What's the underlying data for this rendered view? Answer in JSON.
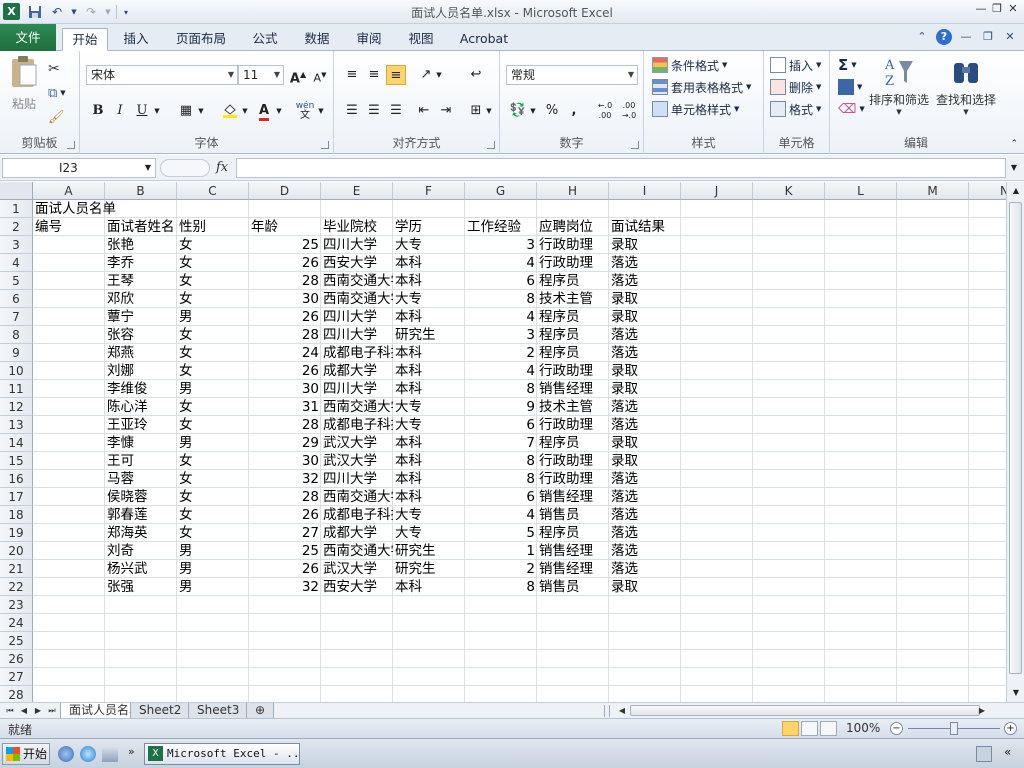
{
  "window": {
    "title": "面试人员名单.xlsx - Microsoft Excel",
    "app_icon": "X"
  },
  "ribbon_tabs": [
    "文件",
    "开始",
    "插入",
    "页面布局",
    "公式",
    "数据",
    "审阅",
    "视图",
    "Acrobat"
  ],
  "ribbon": {
    "clipboard": {
      "label": "剪贴板",
      "paste": "粘贴"
    },
    "font": {
      "label": "字体",
      "font_name": "宋体",
      "font_size": "11",
      "bold": "B",
      "italic": "I",
      "underline": "U",
      "grow": "A",
      "shrink": "A",
      "color_a": "A",
      "phonetic": "wén"
    },
    "alignment": {
      "label": "对齐方式"
    },
    "number": {
      "label": "数字",
      "format": "常规",
      "percent": "%",
      "comma": ",",
      "inc": "←.0 .00",
      "dec": ".00 →.0"
    },
    "styles": {
      "label": "样式",
      "conditional": "条件格式",
      "table": "套用表格格式",
      "cell_styles": "单元格样式"
    },
    "cells": {
      "label": "单元格",
      "insert": "插入",
      "delete": "删除",
      "format": "格式"
    },
    "editing": {
      "label": "编辑",
      "sum": "Σ",
      "sort": "排序和筛选",
      "find": "查找和选择"
    }
  },
  "formula_bar": {
    "name_box": "I23",
    "fx": "fx",
    "formula": ""
  },
  "columns": [
    "A",
    "B",
    "C",
    "D",
    "E",
    "F",
    "G",
    "H",
    "I",
    "J",
    "K",
    "L",
    "M",
    "N"
  ],
  "row_numbers": [
    "1",
    "2",
    "3",
    "4",
    "5",
    "6",
    "7",
    "8",
    "9",
    "10",
    "11",
    "12",
    "13",
    "14",
    "15",
    "16",
    "17",
    "18",
    "19",
    "20",
    "21",
    "22",
    "23",
    "24",
    "25",
    "26",
    "27",
    "28"
  ],
  "sheet": {
    "title": "面试人员名单",
    "headers": [
      "编号",
      "面试者姓名",
      "性别",
      "年龄",
      "毕业院校",
      "学历",
      "工作经验",
      "应聘岗位",
      "面试结果"
    ],
    "rows": [
      [
        "",
        "张艳",
        "女",
        "25",
        "四川大学",
        "大专",
        "3",
        "行政助理",
        "录取"
      ],
      [
        "",
        "李乔",
        "女",
        "26",
        "西安大学",
        "本科",
        "4",
        "行政助理",
        "落选"
      ],
      [
        "",
        "王琴",
        "女",
        "28",
        "西南交通大学",
        "本科",
        "6",
        "程序员",
        "落选"
      ],
      [
        "",
        "邓欣",
        "女",
        "30",
        "西南交通大学",
        "大专",
        "8",
        "技术主管",
        "录取"
      ],
      [
        "",
        "蕈宁",
        "男",
        "26",
        "四川大学",
        "本科",
        "4",
        "程序员",
        "录取"
      ],
      [
        "",
        "张容",
        "女",
        "28",
        "四川大学",
        "研究生",
        "3",
        "程序员",
        "落选"
      ],
      [
        "",
        "郑燕",
        "女",
        "24",
        "成都电子科技大学",
        "本科",
        "2",
        "程序员",
        "落选"
      ],
      [
        "",
        "刘娜",
        "女",
        "26",
        "成都大学",
        "本科",
        "4",
        "行政助理",
        "录取"
      ],
      [
        "",
        "李维俊",
        "男",
        "30",
        "四川大学",
        "本科",
        "8",
        "销售经理",
        "录取"
      ],
      [
        "",
        "陈心洋",
        "女",
        "31",
        "西南交通大学",
        "大专",
        "9",
        "技术主管",
        "落选"
      ],
      [
        "",
        "王亚玲",
        "女",
        "28",
        "成都电子科技大学",
        "大专",
        "6",
        "行政助理",
        "落选"
      ],
      [
        "",
        "李慷",
        "男",
        "29",
        "武汉大学",
        "本科",
        "7",
        "程序员",
        "录取"
      ],
      [
        "",
        "王可",
        "女",
        "30",
        "武汉大学",
        "本科",
        "8",
        "行政助理",
        "录取"
      ],
      [
        "",
        "马蓉",
        "女",
        "32",
        "四川大学",
        "本科",
        "8",
        "行政助理",
        "落选"
      ],
      [
        "",
        "侯晓蓉",
        "女",
        "28",
        "西南交通大学",
        "本科",
        "6",
        "销售经理",
        "落选"
      ],
      [
        "",
        "郭春莲",
        "女",
        "26",
        "成都电子科技大学",
        "大专",
        "4",
        "销售员",
        "落选"
      ],
      [
        "",
        "郑海英",
        "女",
        "27",
        "成都大学",
        "大专",
        "5",
        "程序员",
        "落选"
      ],
      [
        "",
        "刘奇",
        "男",
        "25",
        "西南交通大学",
        "研究生",
        "1",
        "销售经理",
        "落选"
      ],
      [
        "",
        "杨兴武",
        "男",
        "26",
        "武汉大学",
        "研究生",
        "2",
        "销售经理",
        "落选"
      ],
      [
        "",
        "张强",
        "男",
        "32",
        "西安大学",
        "本科",
        "8",
        "销售员",
        "录取"
      ]
    ]
  },
  "sheet_tabs": [
    "面试人员名单",
    "Sheet2",
    "Sheet3"
  ],
  "status": {
    "ready": "就绪",
    "zoom": "100%",
    "zoom_level_percent": 100
  },
  "taskbar": {
    "start": "开始",
    "task": "Microsoft Excel - ..."
  },
  "colors": {
    "file_tab": "#217346",
    "accent_on": "#fbd46c",
    "excel_green": "#1e7145"
  }
}
